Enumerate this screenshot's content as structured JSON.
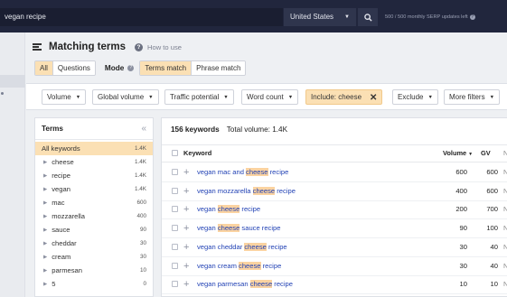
{
  "topbar": {
    "search_value": "vegan recipe",
    "country": "United States",
    "quota": "500 / 500 monthly SERP updates left"
  },
  "header": {
    "title": "Matching terms",
    "how_to": "How to use"
  },
  "scope_tabs": [
    {
      "label": "All",
      "active": true
    },
    {
      "label": "Questions",
      "active": false
    }
  ],
  "mode": {
    "label": "Mode",
    "options": [
      {
        "label": "Terms match",
        "active": true
      },
      {
        "label": "Phrase match",
        "active": false
      }
    ]
  },
  "filters": {
    "volume": "Volume",
    "global_volume": "Global volume",
    "traffic_potential": "Traffic potential",
    "word_count": "Word count",
    "include": "Include: cheese",
    "exclude": "Exclude",
    "more": "More filters"
  },
  "terms": {
    "title": "Terms",
    "items": [
      {
        "label": "All keywords",
        "count": "1.4K"
      },
      {
        "label": "cheese",
        "count": "1.4K"
      },
      {
        "label": "recipe",
        "count": "1.4K"
      },
      {
        "label": "vegan",
        "count": "1.4K"
      },
      {
        "label": "mac",
        "count": "600"
      },
      {
        "label": "mozzarella",
        "count": "400"
      },
      {
        "label": "sauce",
        "count": "90"
      },
      {
        "label": "cheddar",
        "count": "30"
      },
      {
        "label": "cream",
        "count": "30"
      },
      {
        "label": "parmesan",
        "count": "10"
      },
      {
        "label": "5",
        "count": "0"
      }
    ]
  },
  "keywords": {
    "count_label": "156 keywords",
    "total_volume": "Total volume: 1.4K",
    "columns": {
      "keyword": "Keyword",
      "volume": "Volume",
      "gv": "GV",
      "extra": "N"
    },
    "highlight": "cheese",
    "rows": [
      {
        "keyword": "vegan mac and cheese recipe",
        "volume": "600",
        "gv": "600",
        "extra": "N"
      },
      {
        "keyword": "vegan mozzarella cheese recipe",
        "volume": "400",
        "gv": "600",
        "extra": "N"
      },
      {
        "keyword": "vegan cheese recipe",
        "volume": "200",
        "gv": "700",
        "extra": "N"
      },
      {
        "keyword": "vegan cheese sauce recipe",
        "volume": "90",
        "gv": "100",
        "extra": "N"
      },
      {
        "keyword": "vegan cheddar cheese recipe",
        "volume": "30",
        "gv": "40",
        "extra": "N"
      },
      {
        "keyword": "vegan cream cheese recipe",
        "volume": "30",
        "gv": "40",
        "extra": "N"
      },
      {
        "keyword": "vegan parmesan cheese recipe",
        "volume": "10",
        "gv": "10",
        "extra": "N"
      }
    ]
  }
}
